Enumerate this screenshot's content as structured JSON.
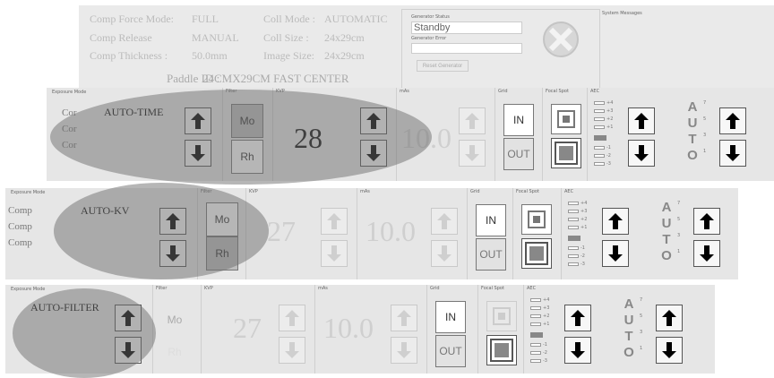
{
  "header": {
    "comp_force_label": "Comp Force  Mode:",
    "comp_force_value": "FULL",
    "comp_release_label": "Comp Release",
    "comp_release_value": "MANUAL",
    "comp_thickness_label": "Comp Thickness   :",
    "comp_thickness_value": "50.0mm",
    "coll_mode_label": "Coll Mode :",
    "coll_mode_value": "AUTOMATIC",
    "coll_size_label": "Coll Size :",
    "coll_size_value": "24x29cm",
    "image_size_label": "Image Size:",
    "image_size_value": "24x29cm",
    "paddle_label": "Paddle ID :",
    "paddle_value": "24CMX29CM FAST CENTER",
    "generator_status_label": "Generator Status",
    "generator_status_value": "Standby",
    "generator_error_label": "Generator Error",
    "reset_generator": "Reset Generator",
    "system_messages_label": "System Messages"
  },
  "labels": {
    "exposure_mode": "Exposure Mode",
    "filter": "Filter",
    "kvp": "KVP",
    "mas": "mAs",
    "grid": "Grid",
    "focal_spot": "Focal Spot",
    "aec": "AEC"
  },
  "panels": [
    {
      "mode": "AUTO-TIME",
      "filter_top": "Mo",
      "filter_bottom": "Rh",
      "kvp": "28",
      "mas": "10.0",
      "grid_in": "IN",
      "grid_out": "OUT",
      "cut": [
        "Cor",
        "Cor",
        "Cor"
      ]
    },
    {
      "mode": "AUTO-KV",
      "filter_top": "Mo",
      "filter_bottom": "Rh",
      "kvp": "27",
      "mas": "10.0",
      "grid_in": "IN",
      "grid_out": "OUT",
      "cut": [
        "Comp",
        "Comp",
        "Comp"
      ]
    },
    {
      "mode": "AUTO-FILTER",
      "filter_top": "Mo",
      "filter_bottom": "Rh",
      "kvp": "27",
      "mas": "10.0",
      "grid_in": "IN",
      "grid_out": "OUT",
      "cut": []
    }
  ],
  "aec_ticks": [
    "+4",
    "+3",
    "+2",
    "+1",
    "-1",
    "-2",
    "-3"
  ],
  "auto_letters": [
    "A",
    "U",
    "T",
    "O"
  ],
  "auto_numbers": [
    "7",
    "5",
    "3",
    "1"
  ],
  "icons": {
    "up": "arrow-up-icon",
    "down": "arrow-down-icon",
    "reset": "x-circle-icon"
  }
}
